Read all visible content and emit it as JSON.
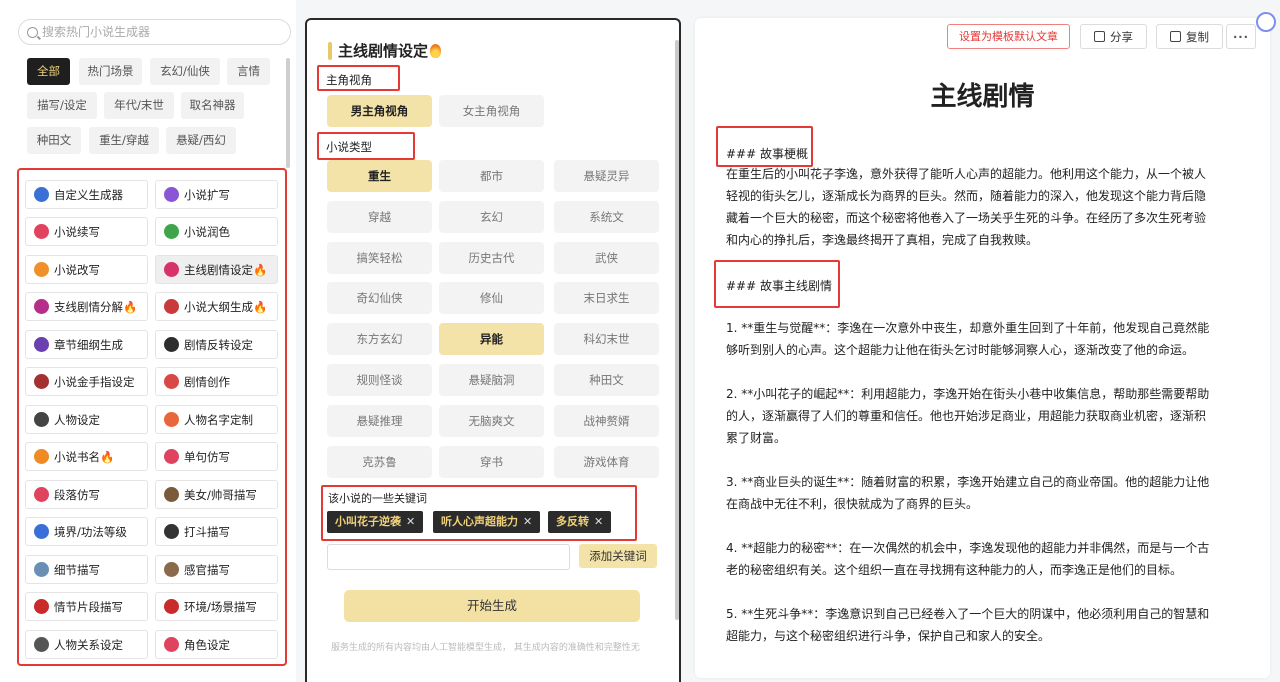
{
  "sidebar": {
    "search_placeholder": "搜索热门小说生成器",
    "tags": [
      "全部",
      "热门场景",
      "玄幻/仙侠",
      "言情",
      "描写/设定",
      "年代/末世",
      "取名神器",
      "种田文",
      "重生/穿越",
      "悬疑/西幻"
    ],
    "tools": [
      {
        "label": "自定义生成器",
        "icon": "custom-icon",
        "color": "#3b6fd8"
      },
      {
        "label": "小说扩写",
        "icon": "expand-icon",
        "color": "#8a56d6"
      },
      {
        "label": "小说续写",
        "icon": "continue-icon",
        "color": "#e0435d"
      },
      {
        "label": "小说润色",
        "icon": "polish-icon",
        "color": "#3fa54a"
      },
      {
        "label": "小说改写",
        "icon": "rewrite-icon",
        "color": "#f0902a"
      },
      {
        "label": "主线剧情设定🔥",
        "icon": "main-plot-icon",
        "color": "#d8326b"
      },
      {
        "label": "支线剧情分解🔥",
        "icon": "subplot-icon",
        "color": "#b72d8a"
      },
      {
        "label": "小说大纲生成🔥",
        "icon": "outline-icon",
        "color": "#c93a3a"
      },
      {
        "label": "章节细纲生成",
        "icon": "chapter-icon",
        "color": "#6b3fb0"
      },
      {
        "label": "剧情反转设定",
        "icon": "twist-icon",
        "color": "#2d2d2d"
      },
      {
        "label": "小说金手指设定",
        "icon": "cheat-icon",
        "color": "#a53030"
      },
      {
        "label": "剧情创作",
        "icon": "plot-create-icon",
        "color": "#d94747"
      },
      {
        "label": "人物设定",
        "icon": "character-icon",
        "color": "#444444"
      },
      {
        "label": "人物名字定制",
        "icon": "name-icon",
        "color": "#e8663a"
      },
      {
        "label": "小说书名🔥",
        "icon": "book-title-icon",
        "color": "#f08a24"
      },
      {
        "label": "单句仿写",
        "icon": "sentence-icon",
        "color": "#e0435d"
      },
      {
        "label": "段落仿写",
        "icon": "paragraph-icon",
        "color": "#e0435d"
      },
      {
        "label": "美女/帅哥描写",
        "icon": "beauty-icon",
        "color": "#7a5a3a"
      },
      {
        "label": "境界/功法等级",
        "icon": "realm-icon",
        "color": "#3b6fd8"
      },
      {
        "label": "打斗描写",
        "icon": "fight-icon",
        "color": "#333333"
      },
      {
        "label": "细节描写",
        "icon": "detail-icon",
        "color": "#6a8fb5"
      },
      {
        "label": "感官描写",
        "icon": "senses-icon",
        "color": "#8a6a4a"
      },
      {
        "label": "情节片段描写",
        "icon": "scene-icon",
        "color": "#c92a2a"
      },
      {
        "label": "环境/场景描写",
        "icon": "environment-icon",
        "color": "#c92a2a"
      },
      {
        "label": "人物关系设定",
        "icon": "relation-icon",
        "color": "#555555"
      },
      {
        "label": "角色设定",
        "icon": "role-icon",
        "color": "#e0435d"
      }
    ]
  },
  "form": {
    "title": "主线剧情设定",
    "perspective_label": "主角视角",
    "perspectives": [
      {
        "label": "男主角视角",
        "selected": true
      },
      {
        "label": "女主角视角",
        "selected": false
      }
    ],
    "genre_label": "小说类型",
    "genres": [
      {
        "label": "重生",
        "selected": true
      },
      {
        "label": "都市",
        "selected": false
      },
      {
        "label": "悬疑灵异",
        "selected": false
      },
      {
        "label": "穿越",
        "selected": false
      },
      {
        "label": "玄幻",
        "selected": false
      },
      {
        "label": "系统文",
        "selected": false
      },
      {
        "label": "搞笑轻松",
        "selected": false
      },
      {
        "label": "历史古代",
        "selected": false
      },
      {
        "label": "武侠",
        "selected": false
      },
      {
        "label": "奇幻仙侠",
        "selected": false
      },
      {
        "label": "修仙",
        "selected": false
      },
      {
        "label": "末日求生",
        "selected": false
      },
      {
        "label": "东方玄幻",
        "selected": false
      },
      {
        "label": "异能",
        "selected": true
      },
      {
        "label": "科幻末世",
        "selected": false
      },
      {
        "label": "规则怪谈",
        "selected": false
      },
      {
        "label": "悬疑脑洞",
        "selected": false
      },
      {
        "label": "种田文",
        "selected": false
      },
      {
        "label": "悬疑推理",
        "selected": false
      },
      {
        "label": "无脑爽文",
        "selected": false
      },
      {
        "label": "战神赘婿",
        "selected": false
      },
      {
        "label": "克苏鲁",
        "selected": false
      },
      {
        "label": "穿书",
        "selected": false
      },
      {
        "label": "游戏体育",
        "selected": false
      }
    ],
    "keywords_label": "该小说的一些关键词",
    "keywords": [
      "小叫花子逆袭",
      "听人心声超能力",
      "多反转"
    ],
    "keyword_input_value": "",
    "add_keyword_label": "添加关键词",
    "generate_label": "开始生成",
    "disclaimer": "服务生成的所有内容均由人工智能模型生成， 其生成内容的准确性和完整性无"
  },
  "document": {
    "set_default_label": "设置为模板默认文章",
    "share_label": "分享",
    "copy_label": "复制",
    "more_label": "···",
    "title": "主线剧情",
    "heading1": "### 故事梗概",
    "summary": "在重生后的小叫花子李逸，意外获得了能听人心声的超能力。他利用这个能力，从一个被人轻视的街头乞儿，逐渐成长为商界的巨头。然而，随着能力的深入，他发现这个能力背后隐藏着一个巨大的秘密，而这个秘密将他卷入了一场关乎生死的斗争。在经历了多次生死考验和内心的挣扎后，李逸最终揭开了真相，完成了自我救赎。",
    "heading2": "### 故事主线剧情",
    "points": [
      "1. **重生与觉醒**：李逸在一次意外中丧生，却意外重生回到了十年前，他发现自己竟然能够听到别人的心声。这个超能力让他在街头乞讨时能够洞察人心，逐渐改变了他的命运。",
      "2. **小叫花子的崛起**：利用超能力，李逸开始在街头小巷中收集信息，帮助那些需要帮助的人，逐渐赢得了人们的尊重和信任。他也开始涉足商业，用超能力获取商业机密，逐渐积累了财富。",
      "3. **商业巨头的诞生**：随着财富的积累，李逸开始建立自己的商业帝国。他的超能力让他在商战中无往不利，很快就成为了商界的巨头。",
      "4. **超能力的秘密**：在一次偶然的机会中，李逸发现他的超能力并非偶然，而是与一个古老的秘密组织有关。这个组织一直在寻找拥有这种能力的人，而李逸正是他们的目标。",
      "5. **生死斗争**：李逸意识到自己已经卷入了一个巨大的阴谋中，他必须利用自己的智慧和超能力，与这个秘密组织进行斗争，保护自己和家人的安全。"
    ]
  },
  "colors": {
    "accent": "#e53935",
    "gold": "#f3e3a8",
    "dark": "#2b2b2b"
  }
}
